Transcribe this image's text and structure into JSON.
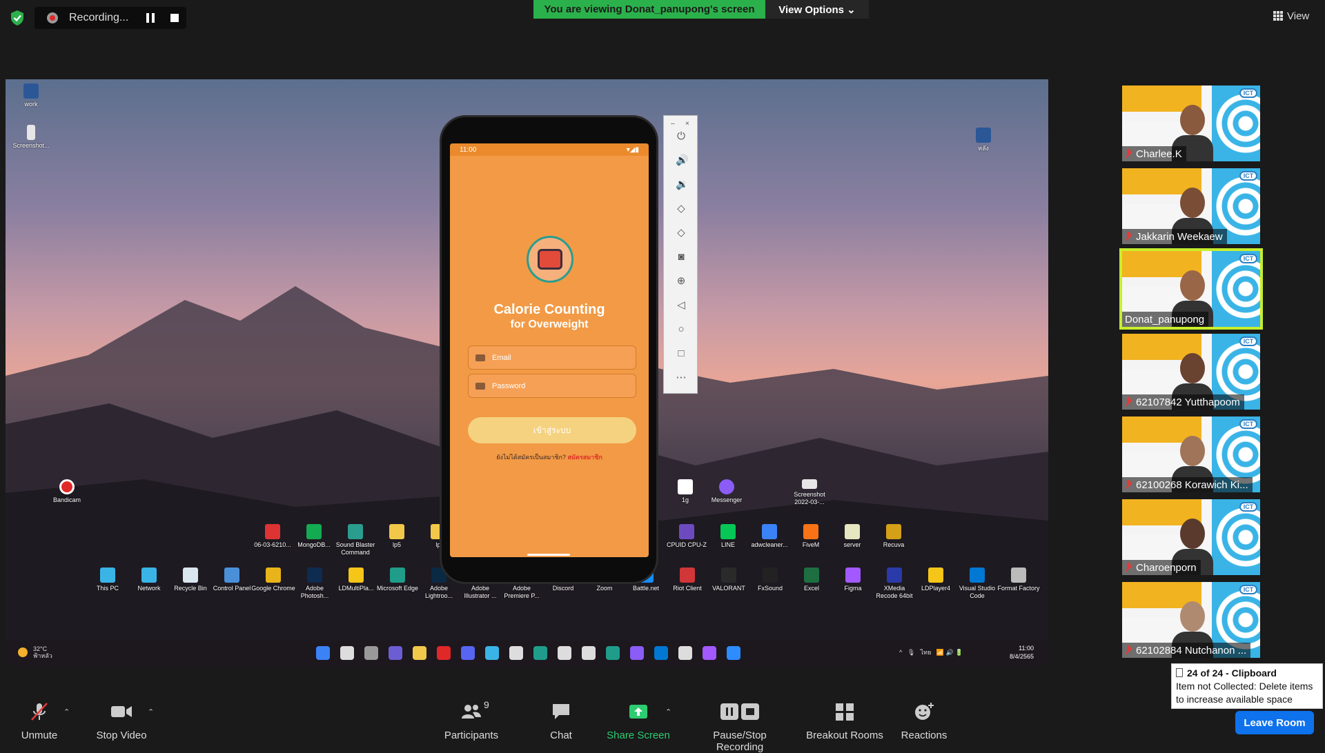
{
  "recording": {
    "label": "Recording..."
  },
  "banner": {
    "viewing": "You are viewing Donat_panupong's screen",
    "view_options": "View Options ⌄"
  },
  "view_button": {
    "label": "View"
  },
  "desktop": {
    "top_icons": [
      {
        "label": "work",
        "color": "#2b5797"
      },
      {
        "label": "Screenshot...",
        "color": "#e6e6e6"
      },
      {
        "label": "หลัง",
        "color": "#2b5797"
      }
    ],
    "mid_icons": [
      {
        "label": "Bandicam",
        "color": "#e02828"
      },
      {
        "label": "1g",
        "color": "#ffffff"
      },
      {
        "label": "Messenger",
        "color": "#8b5cf6"
      },
      {
        "label": "Screenshot 2022-03-...",
        "color": "#e6e6e6"
      }
    ],
    "row1": [
      {
        "label": "06-03-6210...",
        "color": "#d33"
      },
      {
        "label": "MongoDB...",
        "color": "#13aa52"
      },
      {
        "label": "Sound Blaster Command",
        "color": "#2a9d8f"
      },
      {
        "label": "lp5",
        "color": "#f2c84b"
      },
      {
        "label": "lp",
        "color": "#f2c84b"
      },
      {
        "label": "CPUID CPU-Z",
        "color": "#6d4bbf"
      },
      {
        "label": "LINE",
        "color": "#06c755"
      },
      {
        "label": "adwcleaner...",
        "color": "#3b82f6"
      },
      {
        "label": "FiveM",
        "color": "#f97316"
      },
      {
        "label": "server",
        "color": "#e6e6c0"
      },
      {
        "label": "Recuva",
        "color": "#d4a017"
      }
    ],
    "row2": [
      {
        "label": "This PC",
        "color": "#3ab4e6"
      },
      {
        "label": "Network",
        "color": "#3ab4e6"
      },
      {
        "label": "Recycle Bin",
        "color": "#d9e6ef"
      },
      {
        "label": "Control Panel",
        "color": "#4a90d9"
      },
      {
        "label": "Google Chrome",
        "color": "#e8b419"
      },
      {
        "label": "Adobe Photosh...",
        "color": "#0d2c4f"
      },
      {
        "label": "LDMultiPla...",
        "color": "#f5c518"
      },
      {
        "label": "Microsoft Edge",
        "color": "#1f9d8a"
      },
      {
        "label": "Adobe Lightroo...",
        "color": "#0a2a44"
      },
      {
        "label": "Adobe Illustrator ...",
        "color": "#2b1800"
      },
      {
        "label": "Adobe Premiere P...",
        "color": "#1a0b3d"
      },
      {
        "label": "Discord",
        "color": "#5865f2"
      },
      {
        "label": "Zoom",
        "color": "#2d8cff"
      },
      {
        "label": "Battle.net",
        "color": "#148eff"
      },
      {
        "label": "Riot Client",
        "color": "#d13639"
      },
      {
        "label": "VALORANT",
        "color": "#2a2a2a"
      },
      {
        "label": "FxSound",
        "color": "#222222"
      },
      {
        "label": "Excel",
        "color": "#1d6f42"
      },
      {
        "label": "Figma",
        "color": "#a259ff"
      },
      {
        "label": "XMedia Recode 64bit",
        "color": "#2a3aa8"
      },
      {
        "label": "LDPlayer4",
        "color": "#f5c518"
      },
      {
        "label": "Visual Studio Code",
        "color": "#0078d4"
      },
      {
        "label": "Format Factory",
        "color": "#bbbbbb"
      }
    ],
    "weather": {
      "temp": "32°C",
      "desc": "ฟ้าหลัว"
    },
    "clock": {
      "time": "11:00",
      "date": "8/4/2565"
    }
  },
  "phone": {
    "status_time": "11:00",
    "title": "Calorie Counting",
    "subtitle": "for Overweight",
    "email_placeholder": "Email",
    "password_placeholder": "Password",
    "login_label": "เข้าสู่ระบบ",
    "signup_prompt": "ยังไม่ได้สมัครเป็นสมาชิก?",
    "signup_link": "สมัครสมาชิก"
  },
  "participants": [
    {
      "name": "Charlee.K",
      "muted": true
    },
    {
      "name": "Jakkarin Weekaew",
      "muted": true
    },
    {
      "name": "Donat_panupong",
      "muted": false,
      "active": true
    },
    {
      "name": "62107842 Yutthapoom",
      "muted": true
    },
    {
      "name": "62100268 Korawich Ki...",
      "muted": true
    },
    {
      "name": "Charoenporn",
      "muted": true
    },
    {
      "name": "62102884 Nutchanon ...",
      "muted": true
    }
  ],
  "clipboard": {
    "title": "24 of 24 - Clipboard",
    "message": "Item not Collected: Delete items to increase available space"
  },
  "toolbar": {
    "unmute": "Unmute",
    "stop_video": "Stop Video",
    "participants": "Participants",
    "participants_count": "9",
    "chat": "Chat",
    "share_screen": "Share Screen",
    "pause_stop_recording": "Pause/Stop Recording",
    "breakout_rooms": "Breakout Rooms",
    "reactions": "Reactions",
    "leave_room": "Leave Room"
  },
  "colors": {
    "accent_green": "#2bb14b",
    "leave_blue": "#0e72ed",
    "active_speaker": "#c7ef2b",
    "app_orange": "#f29a45"
  }
}
